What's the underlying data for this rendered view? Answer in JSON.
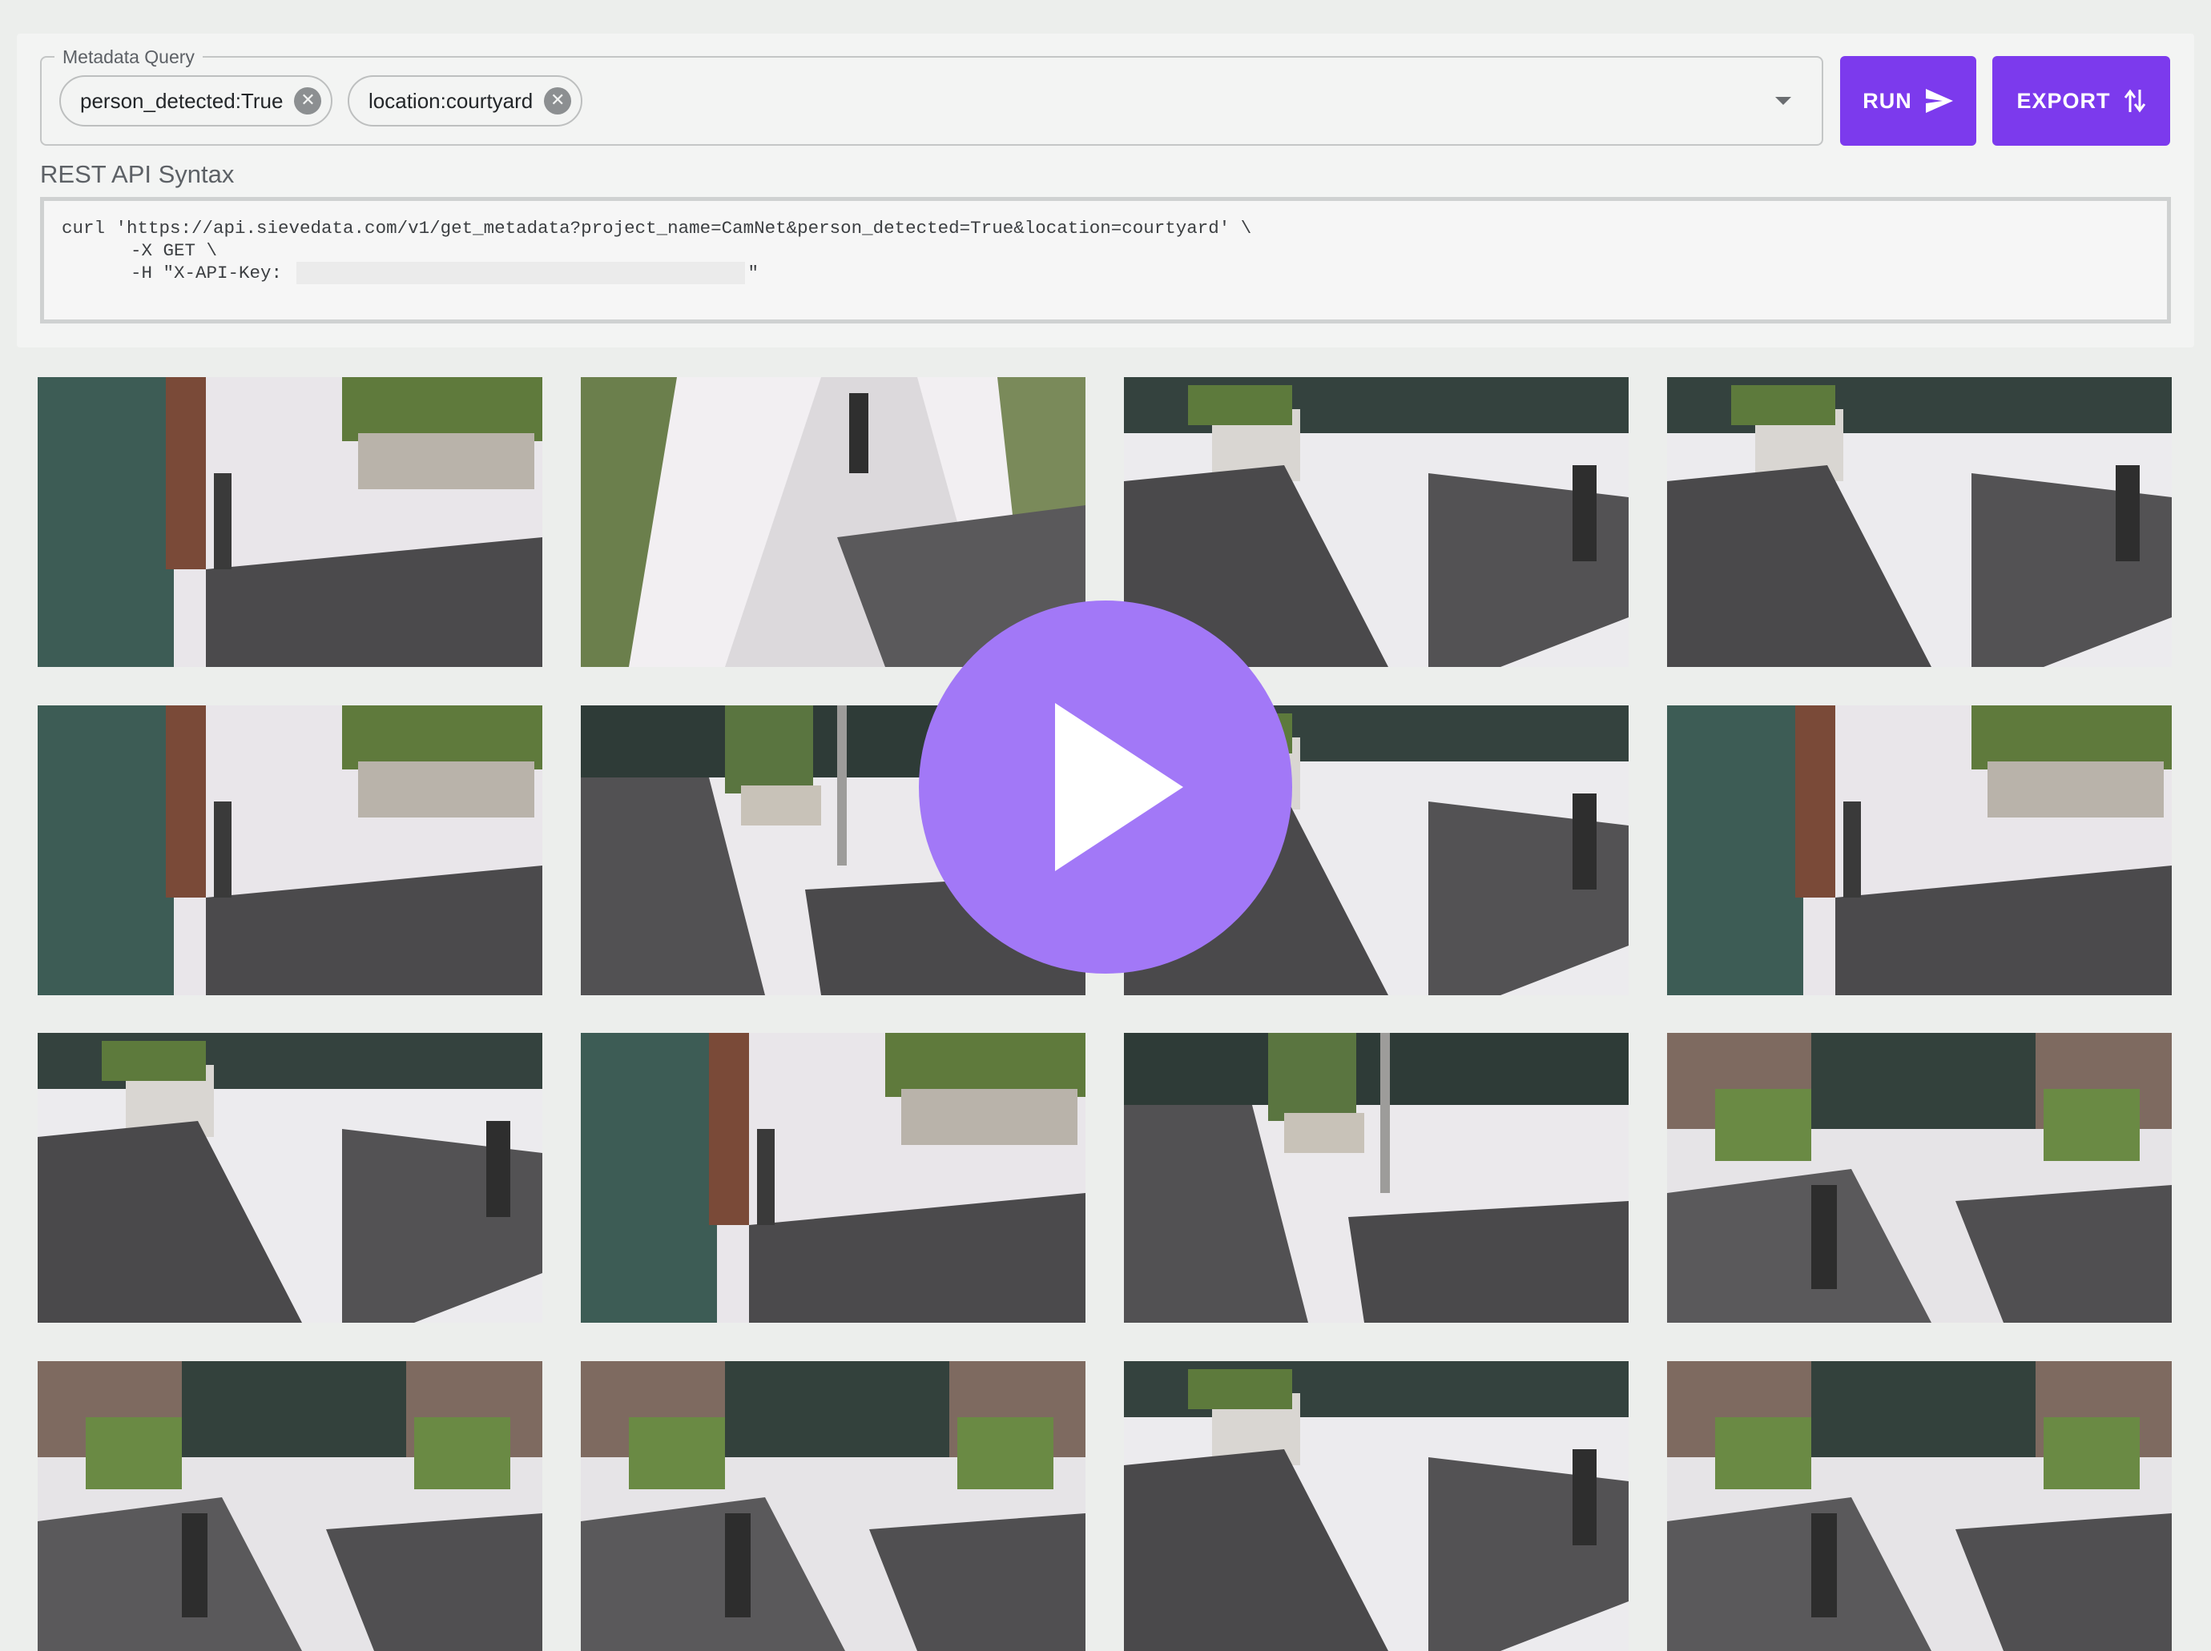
{
  "query": {
    "legend": "Metadata Query",
    "chips": [
      {
        "label": "person_detected:True"
      },
      {
        "label": "location:courtyard"
      }
    ]
  },
  "buttons": {
    "run_label": "RUN",
    "run_icon": "send-icon",
    "export_label": "EXPORT",
    "export_icon": "swap-vert-icon",
    "accent_color": "#7c3aed"
  },
  "api": {
    "title": "REST API Syntax",
    "line1": "curl 'https://api.sievedata.com/v1/get_metadata?project_name=CamNet&person_detected=True&location=courtyard' \\",
    "line2": "-X GET \\",
    "line3_prefix": "-H \"X-API-Key: ",
    "line3_suffix": "\""
  },
  "gallery": {
    "thumbnails": [
      {
        "scene": "building-wall"
      },
      {
        "scene": "walkway"
      },
      {
        "scene": "courtyard-benches"
      },
      {
        "scene": "courtyard-benches"
      },
      {
        "scene": "building-wall"
      },
      {
        "scene": "bench-pole"
      },
      {
        "scene": "courtyard-benches"
      },
      {
        "scene": "building-wall"
      },
      {
        "scene": "courtyard-benches"
      },
      {
        "scene": "building-wall"
      },
      {
        "scene": "bench-pole"
      },
      {
        "scene": "entrance-plaza"
      },
      {
        "scene": "entrance-plaza"
      },
      {
        "scene": "entrance-plaza"
      },
      {
        "scene": "courtyard-benches"
      },
      {
        "scene": "entrance-plaza"
      }
    ],
    "play_icon": "play-icon",
    "play_color": "#a278f7"
  }
}
